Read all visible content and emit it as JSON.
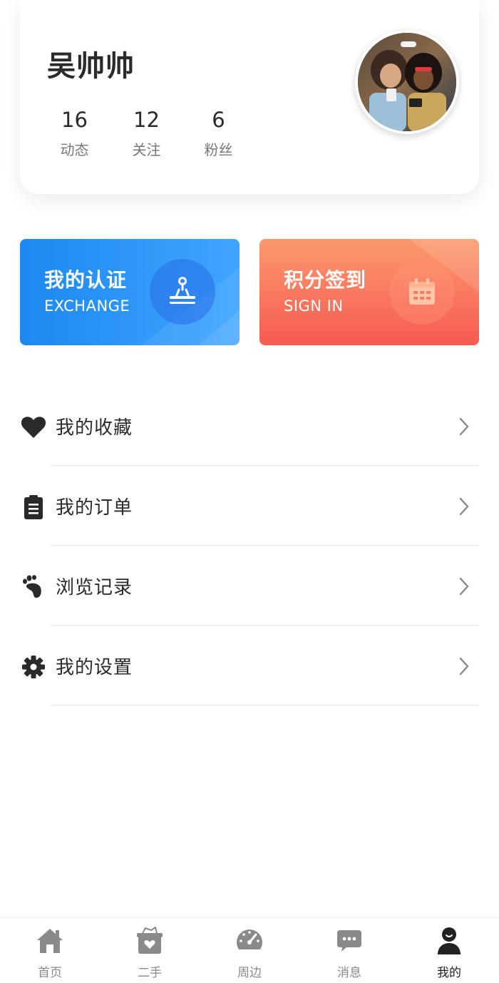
{
  "profile": {
    "name": "吴帅帅",
    "stats": [
      {
        "value": "16",
        "label": "动态"
      },
      {
        "value": "12",
        "label": "关注"
      },
      {
        "value": "6",
        "label": "粉丝"
      }
    ]
  },
  "cards": {
    "certification": {
      "title": "我的认证",
      "subtitle": "EXCHANGE",
      "icon": "stamp-icon"
    },
    "sign_in": {
      "title": "积分签到",
      "subtitle": "SIGN IN",
      "icon": "calendar-icon"
    }
  },
  "menu": [
    {
      "label": "我的收藏",
      "icon": "heart-icon"
    },
    {
      "label": "我的订单",
      "icon": "clipboard-icon"
    },
    {
      "label": "浏览记录",
      "icon": "footprint-icon"
    },
    {
      "label": "我的设置",
      "icon": "gear-icon"
    }
  ],
  "tabbar": {
    "active": "我的",
    "tabs": [
      {
        "label": "首页",
        "icon": "home-icon"
      },
      {
        "label": "二手",
        "icon": "secondhand-box-icon"
      },
      {
        "label": "周边",
        "icon": "speedometer-icon"
      },
      {
        "label": "消息",
        "icon": "chat-bubble-icon"
      },
      {
        "label": "我的",
        "icon": "user-icon"
      }
    ]
  },
  "colors": {
    "cert_gradient_start": "#1e88f0",
    "cert_gradient_end": "#3ea5ff",
    "sign_gradient_start": "#fb9a6e",
    "sign_gradient_end": "#f75a52",
    "text_primary": "#2a2a2a",
    "text_secondary": "#777777",
    "tab_inactive": "#888888"
  }
}
